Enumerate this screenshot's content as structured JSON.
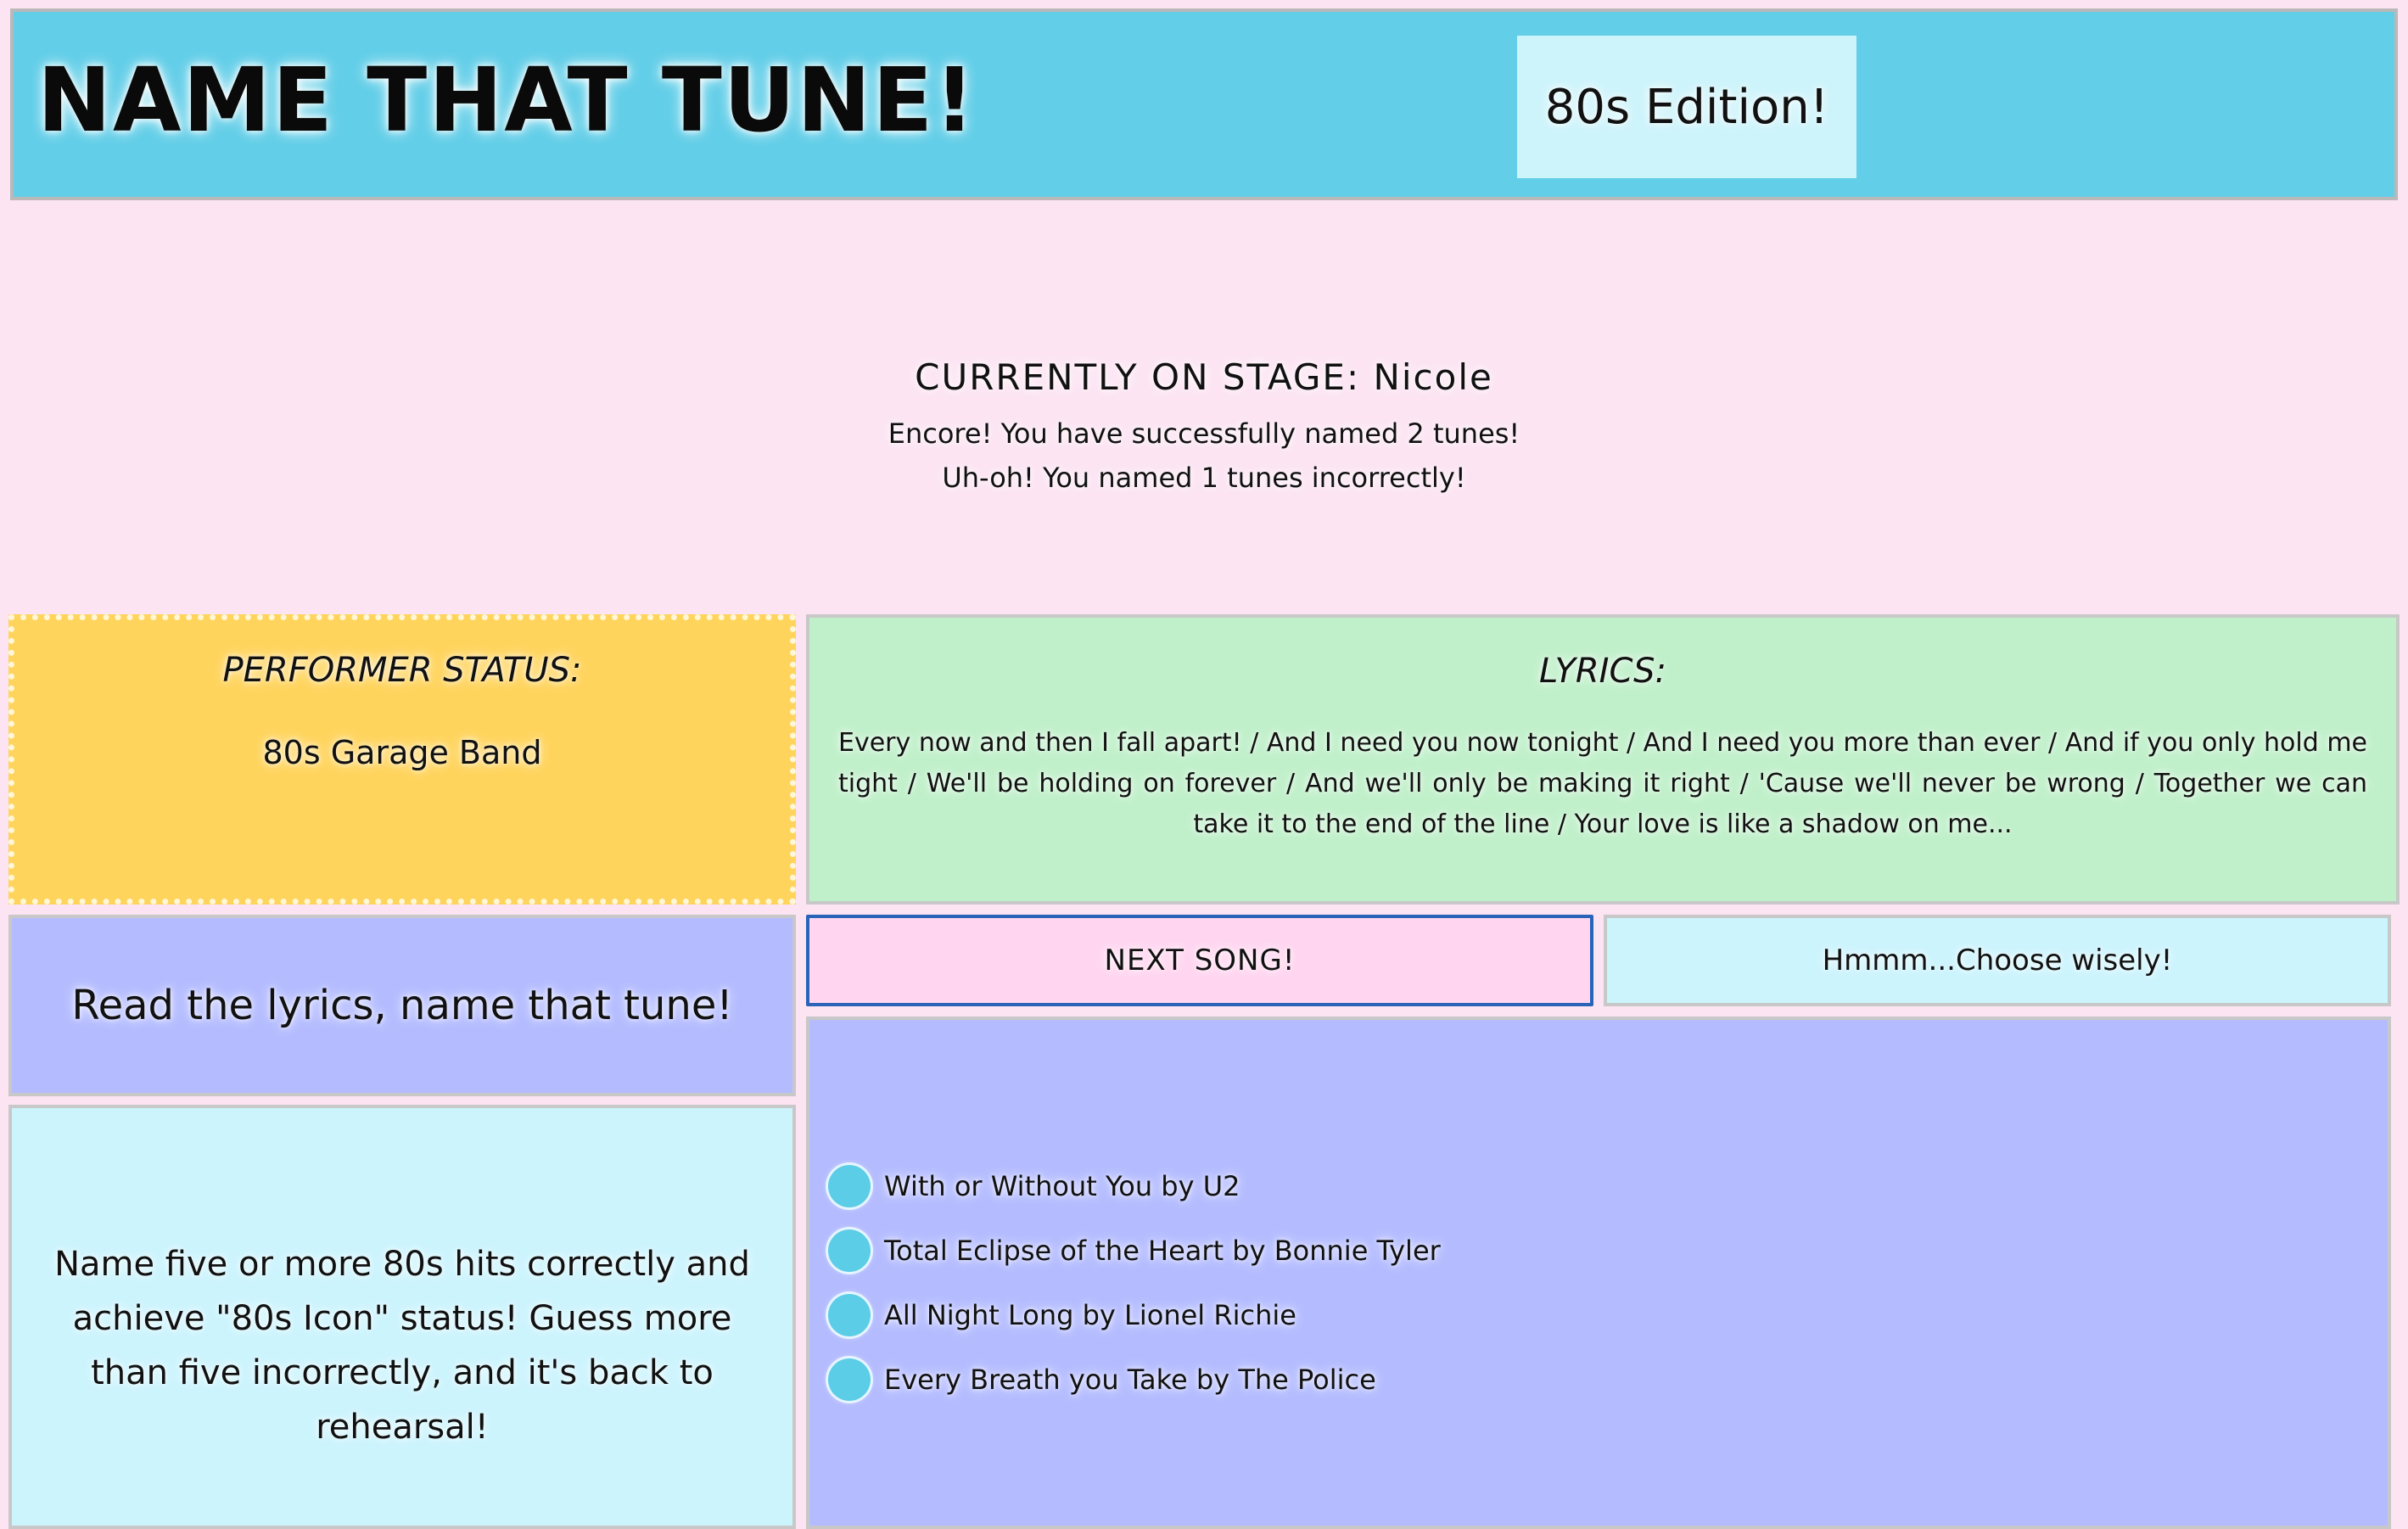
{
  "header": {
    "title": "NAME THAT TUNE!",
    "edition": "80s Edition!"
  },
  "stage": {
    "heading": "CURRENTLY ON STAGE: Nicole",
    "correct_line": "Encore! You have successfully named 2 tunes!",
    "incorrect_line": "Uh-oh! You named 1 tunes incorrectly!"
  },
  "performer": {
    "label": "PERFORMER STATUS:",
    "value": "80s Garage Band"
  },
  "lyrics": {
    "label": "LYRICS:",
    "text": "Every now and then I fall apart! / And I need you now tonight / And I need you more than ever / And if you only hold me tight / We'll be holding on forever / And we'll only be making it right / 'Cause we'll never be wrong / Together we can take it to the end of the line / Your love is like a shadow on me..."
  },
  "instruction": "Read the lyrics, name that tune!",
  "rules": "Name five or more 80s hits correctly and achieve \"80s Icon\" status! Guess more than five incorrectly, and it's back to rehearsal!",
  "buttons": {
    "next_song": "NEXT SONG!",
    "choose": "Hmmm...Choose wisely!"
  },
  "options": [
    "With or Without You by U2",
    "Total Eclipse of the Heart by Bonnie Tyler",
    "All Night Long by Lionel Richie",
    "Every Breath you Take by The Police"
  ],
  "colors": {
    "page_background": "#fce4f3",
    "header": "#62cee8",
    "performer": "#ffd45c",
    "lyrics": "#bff0c9",
    "periwinkle": "#b4bcff",
    "light_cyan": "#cbf4fd",
    "next_button": "#ffd5f0",
    "radio": "#5ccde6"
  }
}
